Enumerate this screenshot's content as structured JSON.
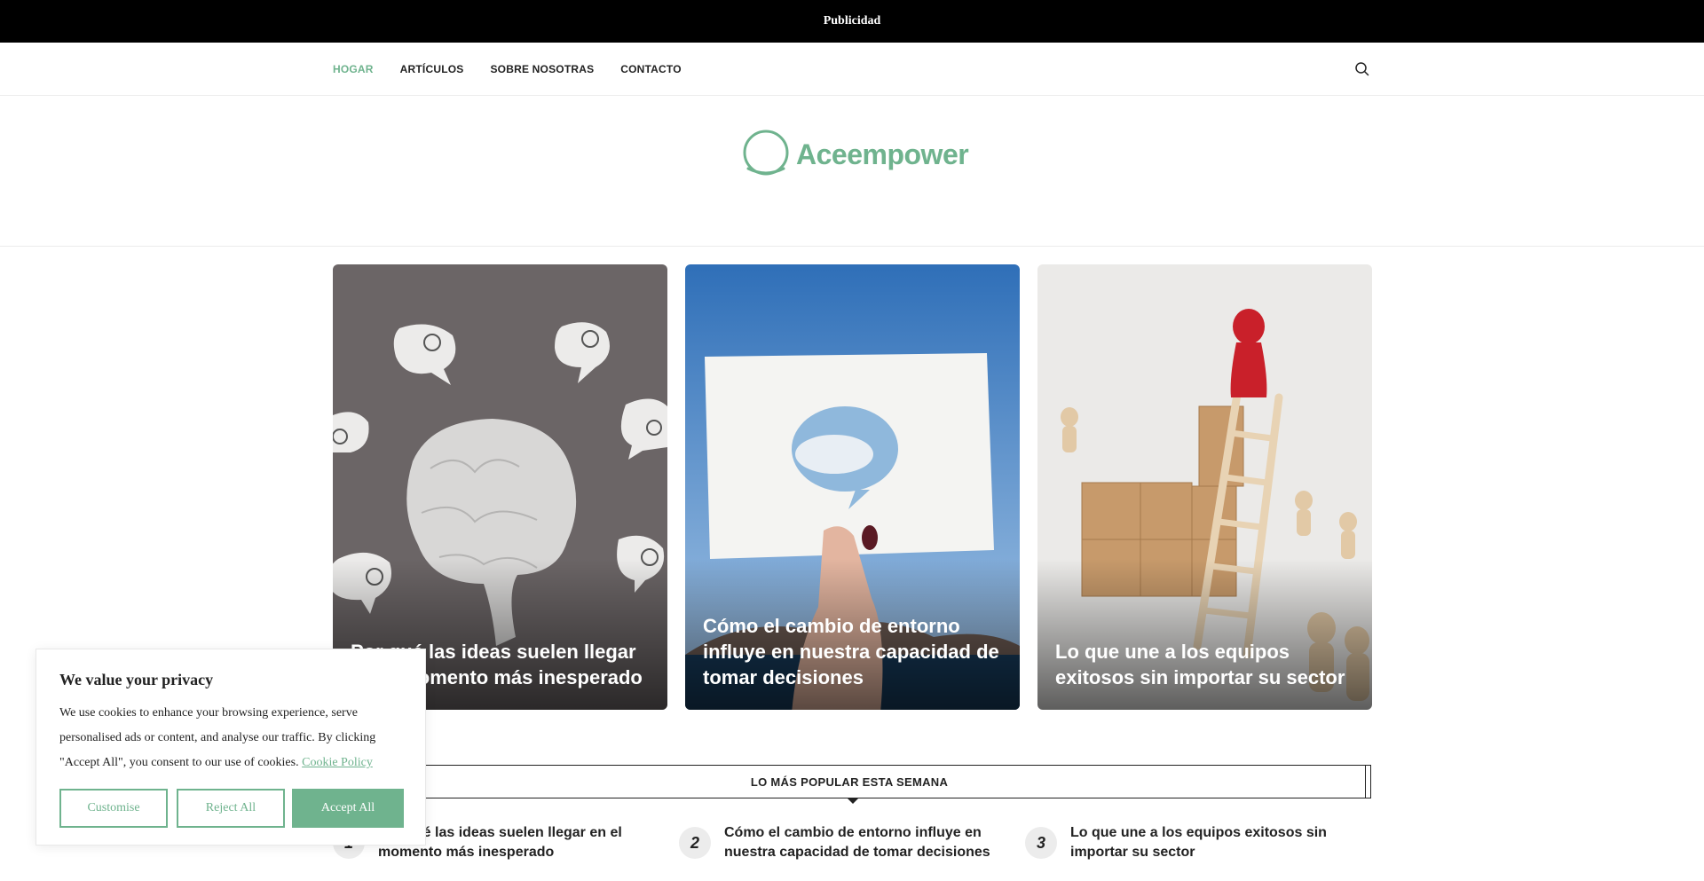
{
  "ad": {
    "label": "Publicidad"
  },
  "nav": {
    "items": [
      {
        "label": "HOGAR",
        "active": true
      },
      {
        "label": "ARTÍCULOS",
        "active": false
      },
      {
        "label": "SOBRE NOSOTRAS",
        "active": false
      },
      {
        "label": "CONTACTO",
        "active": false
      }
    ],
    "search_icon": "search-icon"
  },
  "logo": {
    "text": "Aceempower",
    "color": "#6fb38e"
  },
  "featured": [
    {
      "title": "Por qué las ideas suelen llegar en el momento más inesperado"
    },
    {
      "title": "Cómo el cambio de entorno influye en nuestra capacidad de tomar decisiones"
    },
    {
      "title": "Lo que une a los equipos exitosos sin importar su sector"
    }
  ],
  "popular": {
    "heading": "LO MÁS POPULAR ESTA SEMANA",
    "items": [
      {
        "number": "1",
        "title": "Por qué las ideas suelen llegar en el momento más inesperado"
      },
      {
        "number": "2",
        "title": "Cómo el cambio de entorno influye en nuestra capacidad de tomar decisiones"
      },
      {
        "number": "3",
        "title": "Lo que une a los equipos exitosos sin importar su sector"
      }
    ]
  },
  "cookie": {
    "title": "We value your privacy",
    "text": "We use cookies to enhance your browsing experience, serve personalised ads or content, and analyse our traffic. By clicking \"Accept All\", you consent to our use of cookies.",
    "policy_link": "Cookie Policy",
    "customise": "Customise",
    "reject": "Reject All",
    "accept": "Accept All"
  },
  "colors": {
    "accent": "#6fb38e",
    "adbar": "#000000"
  }
}
